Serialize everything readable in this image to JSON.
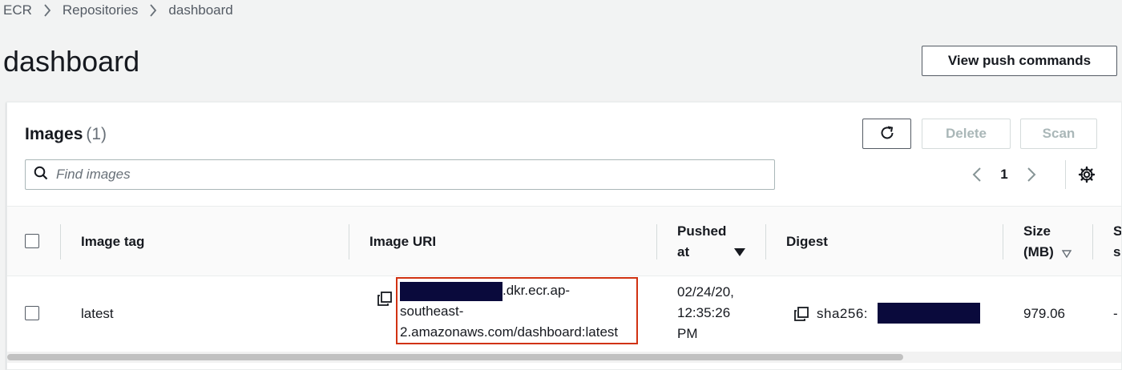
{
  "breadcrumb": {
    "items": [
      "ECR",
      "Repositories"
    ],
    "current": "dashboard"
  },
  "page": {
    "title": "dashboard",
    "push_button": "View push commands"
  },
  "images_panel": {
    "title": "Images",
    "count": "(1)",
    "delete_label": "Delete",
    "scan_label": "Scan",
    "search_placeholder": "Find images",
    "page_number": "1"
  },
  "table": {
    "columns": {
      "tag": "Image tag",
      "uri": "Image URI",
      "pushed_line1": "Pushed",
      "pushed_line2": "at",
      "digest": "Digest",
      "size_line1": "Size",
      "size_line2": "(MB)",
      "extra_line1": "S",
      "extra_line2": "s"
    },
    "rows": [
      {
        "tag": "latest",
        "uri_line1": ".dkr.ecr.ap-",
        "uri_line2": "southeast-",
        "uri_line3": "2.amazonaws.com/dashboard:latest",
        "pushed_line1": "02/24/20,",
        "pushed_line2": "12:35:26",
        "pushed_line3": "PM",
        "digest_prefix": "sha256:",
        "size": "979.06",
        "extra": "-"
      }
    ]
  },
  "colors": {
    "accent_border": "#d13212",
    "redaction": "#0a0a3c"
  },
  "icons": [
    "chevron-right-icon",
    "refresh-icon",
    "search-icon",
    "chevron-left-icon",
    "gear-icon",
    "copy-icon",
    "sort-desc-icon",
    "sort-icon"
  ]
}
